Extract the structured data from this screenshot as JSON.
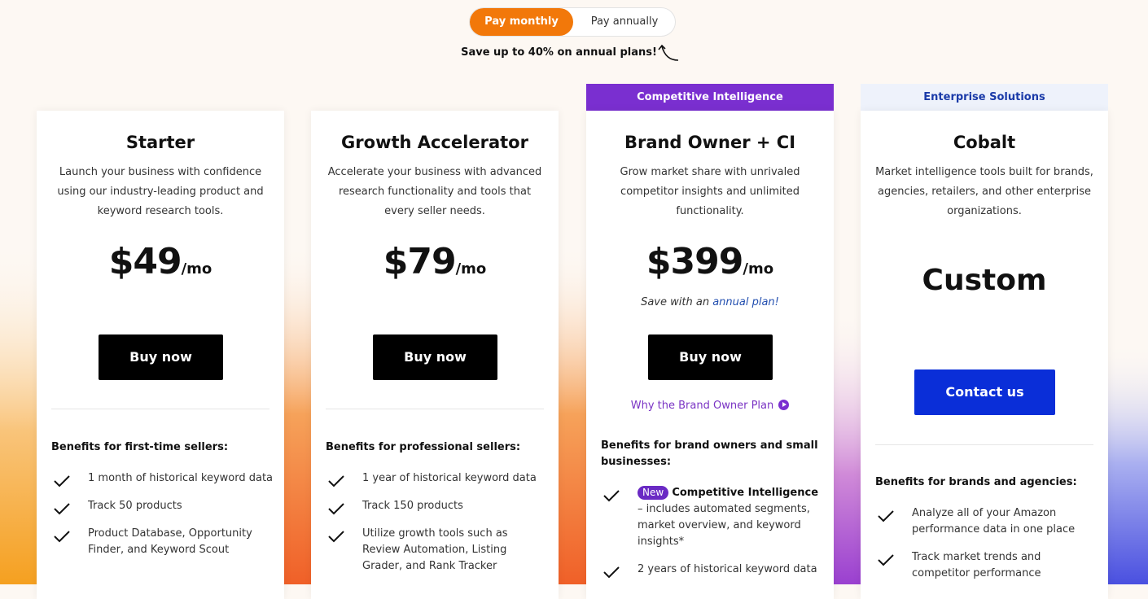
{
  "billing": {
    "monthly_label": "Pay monthly",
    "annual_label": "Pay annually",
    "save_note": "Save up to 40% on annual plans!"
  },
  "plans": [
    {
      "name": "Starter",
      "description": "Launch your business with confidence using our industry-leading product and keyword research tools.",
      "price": "$49",
      "period": "/mo",
      "cta": "Buy now",
      "benefits_title": "Benefits for first-time sellers:",
      "benefits": [
        "1 month of historical keyword data",
        "Track 50 products",
        "Product Database, Opportunity Finder, and Keyword Scout"
      ]
    },
    {
      "name": "Growth Accelerator",
      "description": "Accelerate your business with advanced research functionality and tools that every seller needs.",
      "price": "$79",
      "period": "/mo",
      "cta": "Buy now",
      "benefits_title": "Benefits for professional sellers:",
      "benefits": [
        "1 year of historical keyword data",
        "Track 150 products",
        "Utilize growth tools such as Review Automation, Listing Grader, and Rank Tracker"
      ]
    },
    {
      "banner": "Competitive Intelligence",
      "name": "Brand Owner + CI",
      "description": "Grow market share with unrivaled competitor insights and unlimited functionality.",
      "price": "$399",
      "period": "/mo",
      "save_prefix": "Save with an",
      "save_link": "annual plan!",
      "cta": "Buy now",
      "why_link": "Why the Brand Owner Plan",
      "benefits_title": "Benefits for brand owners and small businesses:",
      "new_badge": "New",
      "ci_title": "Competitive Intelligence",
      "ci_desc": "– includes automated segments, market overview, and keyword insights*",
      "benefits": [
        "2 years of historical keyword data"
      ]
    },
    {
      "banner": "Enterprise Solutions",
      "name": "Cobalt",
      "description": "Market intelligence tools built for brands, agencies, retailers, and other enterprise organizations.",
      "price": "Custom",
      "cta": "Contact us",
      "benefits_title": "Benefits for brands and agencies:",
      "benefits": [
        "Analyze all of your Amazon performance data in one place",
        "Track market trends and competitor performance"
      ]
    }
  ],
  "colors": {
    "accent_orange": "#f2780a",
    "purple": "#7a2fd0",
    "enterprise_blue": "#0a2ed8"
  }
}
